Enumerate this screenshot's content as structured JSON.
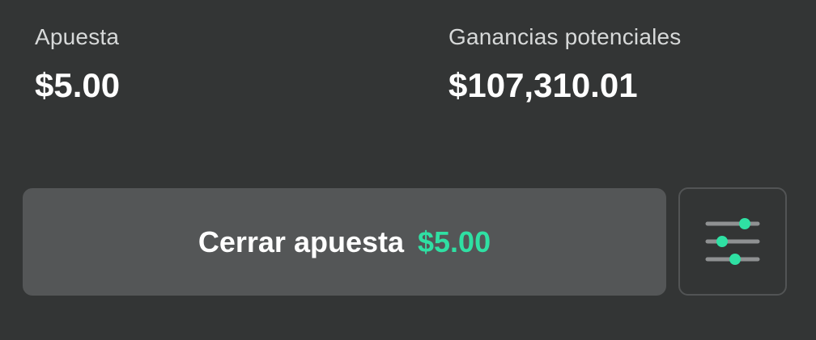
{
  "bet_summary": {
    "stake_label": "Apuesta",
    "stake_value": "$5.00",
    "winnings_label": "Ganancias potenciales",
    "winnings_value": "$107,310.01"
  },
  "cashout": {
    "label": "Cerrar apuesta",
    "amount": "$5.00"
  },
  "settings": {
    "icon": "sliders-icon"
  },
  "colors": {
    "background": "#333535",
    "button_background": "#545657",
    "accent": "#2fe0a3"
  }
}
